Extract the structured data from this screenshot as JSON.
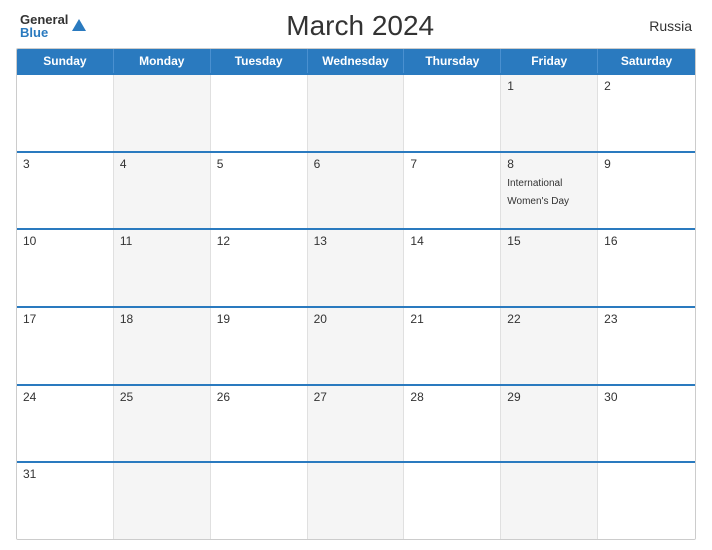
{
  "header": {
    "logo_general": "General",
    "logo_blue": "Blue",
    "title": "March 2024",
    "country": "Russia"
  },
  "weekdays": [
    "Sunday",
    "Monday",
    "Tuesday",
    "Wednesday",
    "Thursday",
    "Friday",
    "Saturday"
  ],
  "weeks": [
    [
      {
        "day": "",
        "event": "",
        "shaded": false
      },
      {
        "day": "",
        "event": "",
        "shaded": true
      },
      {
        "day": "",
        "event": "",
        "shaded": false
      },
      {
        "day": "",
        "event": "",
        "shaded": true
      },
      {
        "day": "",
        "event": "",
        "shaded": false
      },
      {
        "day": "1",
        "event": "",
        "shaded": true
      },
      {
        "day": "2",
        "event": "",
        "shaded": false
      }
    ],
    [
      {
        "day": "3",
        "event": "",
        "shaded": false
      },
      {
        "day": "4",
        "event": "",
        "shaded": true
      },
      {
        "day": "5",
        "event": "",
        "shaded": false
      },
      {
        "day": "6",
        "event": "",
        "shaded": true
      },
      {
        "day": "7",
        "event": "",
        "shaded": false
      },
      {
        "day": "8",
        "event": "International Women's Day",
        "shaded": true
      },
      {
        "day": "9",
        "event": "",
        "shaded": false
      }
    ],
    [
      {
        "day": "10",
        "event": "",
        "shaded": false
      },
      {
        "day": "11",
        "event": "",
        "shaded": true
      },
      {
        "day": "12",
        "event": "",
        "shaded": false
      },
      {
        "day": "13",
        "event": "",
        "shaded": true
      },
      {
        "day": "14",
        "event": "",
        "shaded": false
      },
      {
        "day": "15",
        "event": "",
        "shaded": true
      },
      {
        "day": "16",
        "event": "",
        "shaded": false
      }
    ],
    [
      {
        "day": "17",
        "event": "",
        "shaded": false
      },
      {
        "day": "18",
        "event": "",
        "shaded": true
      },
      {
        "day": "19",
        "event": "",
        "shaded": false
      },
      {
        "day": "20",
        "event": "",
        "shaded": true
      },
      {
        "day": "21",
        "event": "",
        "shaded": false
      },
      {
        "day": "22",
        "event": "",
        "shaded": true
      },
      {
        "day": "23",
        "event": "",
        "shaded": false
      }
    ],
    [
      {
        "day": "24",
        "event": "",
        "shaded": false
      },
      {
        "day": "25",
        "event": "",
        "shaded": true
      },
      {
        "day": "26",
        "event": "",
        "shaded": false
      },
      {
        "day": "27",
        "event": "",
        "shaded": true
      },
      {
        "day": "28",
        "event": "",
        "shaded": false
      },
      {
        "day": "29",
        "event": "",
        "shaded": true
      },
      {
        "day": "30",
        "event": "",
        "shaded": false
      }
    ],
    [
      {
        "day": "31",
        "event": "",
        "shaded": false
      },
      {
        "day": "",
        "event": "",
        "shaded": true
      },
      {
        "day": "",
        "event": "",
        "shaded": false
      },
      {
        "day": "",
        "event": "",
        "shaded": true
      },
      {
        "day": "",
        "event": "",
        "shaded": false
      },
      {
        "day": "",
        "event": "",
        "shaded": true
      },
      {
        "day": "",
        "event": "",
        "shaded": false
      }
    ]
  ]
}
